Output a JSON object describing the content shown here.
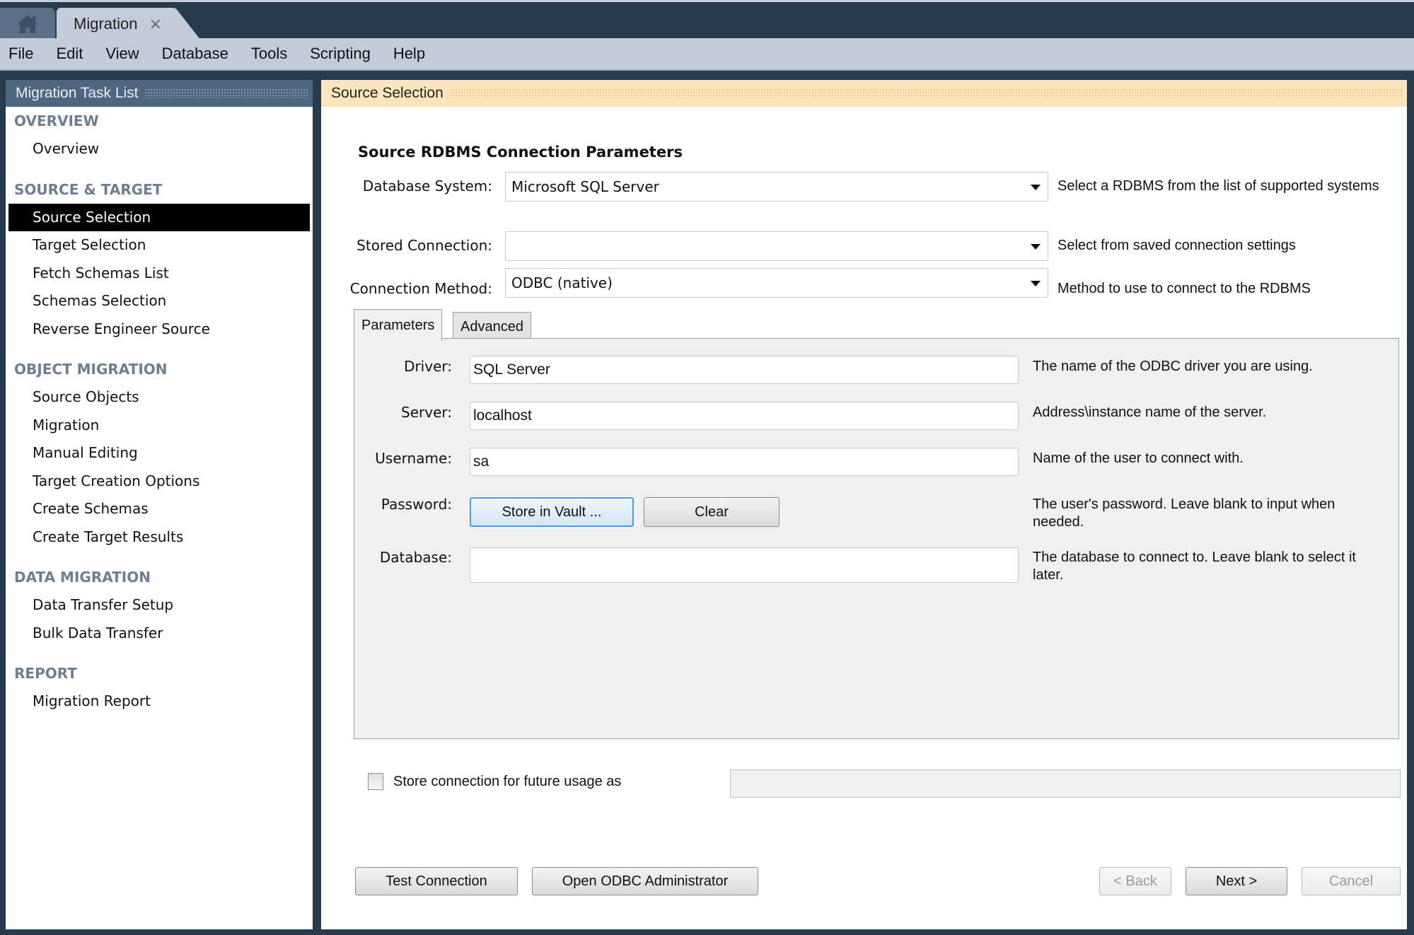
{
  "tabs": {
    "home_icon": "home-icon",
    "document_tab": "Migration",
    "close_glyph": "×"
  },
  "menu": [
    "File",
    "Edit",
    "View",
    "Database",
    "Tools",
    "Scripting",
    "Help"
  ],
  "sidebar": {
    "title": "Migration Task List",
    "sections": [
      {
        "heading": "OVERVIEW",
        "items": [
          "Overview"
        ]
      },
      {
        "heading": "SOURCE & TARGET",
        "items": [
          "Source Selection",
          "Target Selection",
          "Fetch Schemas List",
          "Schemas Selection",
          "Reverse Engineer Source"
        ]
      },
      {
        "heading": "OBJECT MIGRATION",
        "items": [
          "Source Objects",
          "Migration",
          "Manual Editing",
          "Target Creation Options",
          "Create Schemas",
          "Create Target Results"
        ]
      },
      {
        "heading": "DATA MIGRATION",
        "items": [
          "Data Transfer Setup",
          "Bulk Data Transfer"
        ]
      },
      {
        "heading": "REPORT",
        "items": [
          "Migration Report"
        ]
      }
    ],
    "selected": "Source Selection"
  },
  "main": {
    "header": "Source Selection",
    "section_title": "Source RDBMS Connection Parameters",
    "database_system": {
      "label": "Database System:",
      "value": "Microsoft SQL Server",
      "hint": "Select a RDBMS from the list of supported systems"
    },
    "stored_connection": {
      "label": "Stored Connection:",
      "value": "",
      "hint": "Select from saved connection settings"
    },
    "connection_method": {
      "label": "Connection Method:",
      "value": "ODBC (native)",
      "hint": "Method to use to connect to the RDBMS"
    },
    "param_tabs": [
      "Parameters",
      "Advanced"
    ],
    "active_tab": "Parameters",
    "params": {
      "driver": {
        "label": "Driver:",
        "value": "SQL Server",
        "hint": "The name of the ODBC driver you are using."
      },
      "server": {
        "label": "Server:",
        "value": "localhost",
        "hint": "Address\\instance name of the server."
      },
      "username": {
        "label": "Username:",
        "value": "sa",
        "hint": "Name of the user to connect with."
      },
      "password": {
        "label": "Password:",
        "store_button": "Store in Vault ...",
        "clear_button": "Clear",
        "hint": "The user's password. Leave blank to input when needed."
      },
      "database": {
        "label": "Database:",
        "value": "",
        "hint": "The database to connect to. Leave blank to select it later."
      }
    },
    "store_connection": {
      "label": "Store connection for future usage as",
      "checked": false,
      "value": ""
    },
    "buttons": {
      "test_connection": "Test Connection",
      "open_odbc_admin": "Open ODBC Administrator",
      "back": "< Back",
      "next": "Next >",
      "cancel": "Cancel"
    }
  }
}
